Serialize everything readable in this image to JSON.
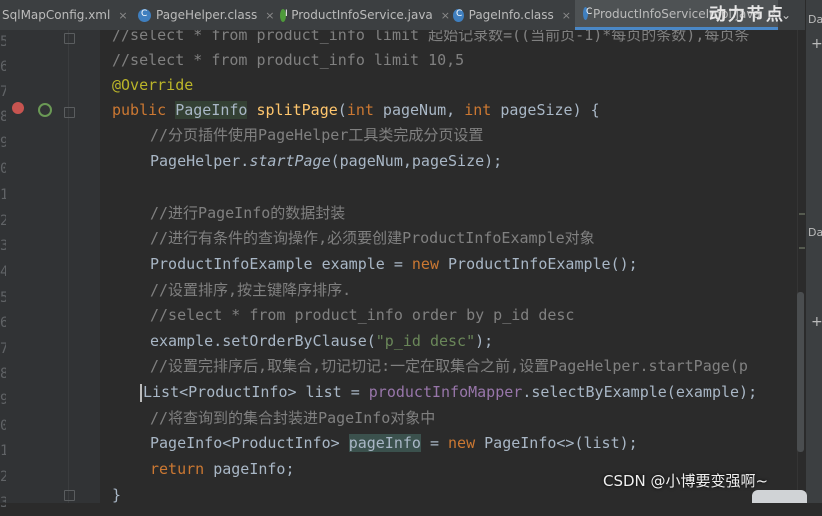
{
  "tabs": [
    {
      "label": "SqlMapConfig.xml",
      "icon": "xml-file-icon",
      "active": false
    },
    {
      "label": "PageHelper.class",
      "icon": "class-file-icon",
      "active": false
    },
    {
      "label": "ProductInfoService.java",
      "icon": "interface-file-icon",
      "active": false
    },
    {
      "label": "PageInfo.class",
      "icon": "class-file-icon",
      "active": false
    },
    {
      "label": "ProductInfoServiceImpl.java",
      "icon": "class-file-icon",
      "active": true
    }
  ],
  "tab_close": "×",
  "tab_overflow": "⌄",
  "overlay_top": "动力节点",
  "gutter": {
    "line_numbers": [
      "5",
      "6",
      "7",
      "8",
      "9",
      "0",
      "1",
      "2",
      "3",
      "4",
      "5",
      "6",
      "7",
      "8",
      "9",
      "0",
      "1",
      "2",
      "3",
      "4"
    ],
    "highlighted_line": "9"
  },
  "side_panel": {
    "labels": [
      "Da",
      "Da"
    ],
    "plus": "+"
  },
  "code": {
    "l1": {
      "t": "//select * from product_info limit 起始记录数=((当前页-1)*每页的条数),每页条"
    },
    "l2": {
      "t": "//select * from product_info limit 10,5"
    },
    "l3": {
      "t": "@Override"
    },
    "l4": {
      "k1": "public ",
      "type": "PageInfo",
      "sp": " ",
      "name": "splitPage",
      "p1": "(",
      "k2": "int",
      "p2": " pageNum, ",
      "k3": "int",
      "p3": " pageSize) {"
    },
    "l5": {
      "t": "//分页插件使用PageHelper工具类完成分页设置"
    },
    "l6": {
      "a": "PageHelper.",
      "b": "startPage",
      "c": "(pageNum,pageSize);"
    },
    "l7": {
      "t": ""
    },
    "l8": {
      "t": "//进行PageInfo的数据封装"
    },
    "l9": {
      "t": "//进行有条件的查询操作,必须要创建ProductInfoExample对象"
    },
    "l10": {
      "a": "ProductInfoExample example = ",
      "k": "new",
      "b": " ProductInfoExample();"
    },
    "l11": {
      "t": "//设置排序,按主键降序排序."
    },
    "l12": {
      "t": "//select * from product_info order by p_id desc"
    },
    "l13": {
      "a": "example.setOrderByClause(",
      "s": "\"p_id desc\"",
      "b": ");"
    },
    "l14": {
      "t": "//设置完排序后,取集合,切记切记:一定在取集合之前,设置PageHelper.startPage(p"
    },
    "l15": {
      "a": "List<ProductInfo> list = ",
      "f": "productInfoMapper",
      "b": ".selectByExample(example);"
    },
    "l16": {
      "t": "//将查询到的集合封装进PageInfo对象中"
    },
    "l17": {
      "a": "PageInfo<ProductInfo> ",
      "v": "pageInfo",
      "b": " = ",
      "k": "new",
      "c": " PageInfo<>(list);"
    },
    "l18": {
      "k": "return",
      "a": " pageInfo;"
    },
    "l19": {
      "t": "}"
    }
  },
  "watermark": "CSDN @小博要变强啊~",
  "colors": {
    "background": "#2b2b2b",
    "keyword": "#cc7832",
    "comment": "#808080",
    "annotation": "#bbb529",
    "method": "#ffc66d",
    "string": "#6a8759",
    "field": "#9876aa",
    "text": "#a9b7c6"
  }
}
